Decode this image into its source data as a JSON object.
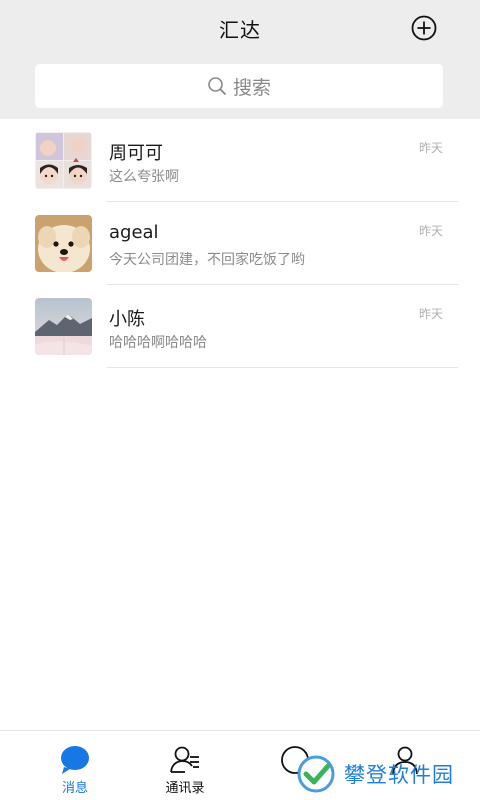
{
  "header": {
    "title": "汇达",
    "add_icon": "plus-circle-icon"
  },
  "search": {
    "placeholder": "搜索",
    "icon": "search-icon"
  },
  "conversations": [
    {
      "name": "周可可",
      "preview": "这么夸张啊",
      "time": "昨天",
      "avatar": "baby-photos-grid"
    },
    {
      "name": "ageal",
      "preview": "今天公司团建，不回家吃饭了哟",
      "time": "昨天",
      "avatar": "fluffy-dog-photo"
    },
    {
      "name": "小陈",
      "preview": "哈哈哈啊哈哈哈",
      "time": "昨天",
      "avatar": "snowy-mountain-photo"
    }
  ],
  "tabs": [
    {
      "label": "消息",
      "icon": "chat-bubble-icon",
      "active": true
    },
    {
      "label": "通讯录",
      "icon": "contacts-icon",
      "active": false
    },
    {
      "label": "",
      "icon": "circle-icon",
      "active": false
    },
    {
      "label": "",
      "icon": "person-icon",
      "active": false
    }
  ],
  "colors": {
    "accent": "#1677e5",
    "header_bg": "#ededed"
  },
  "watermark": {
    "text": "攀登软件园"
  }
}
